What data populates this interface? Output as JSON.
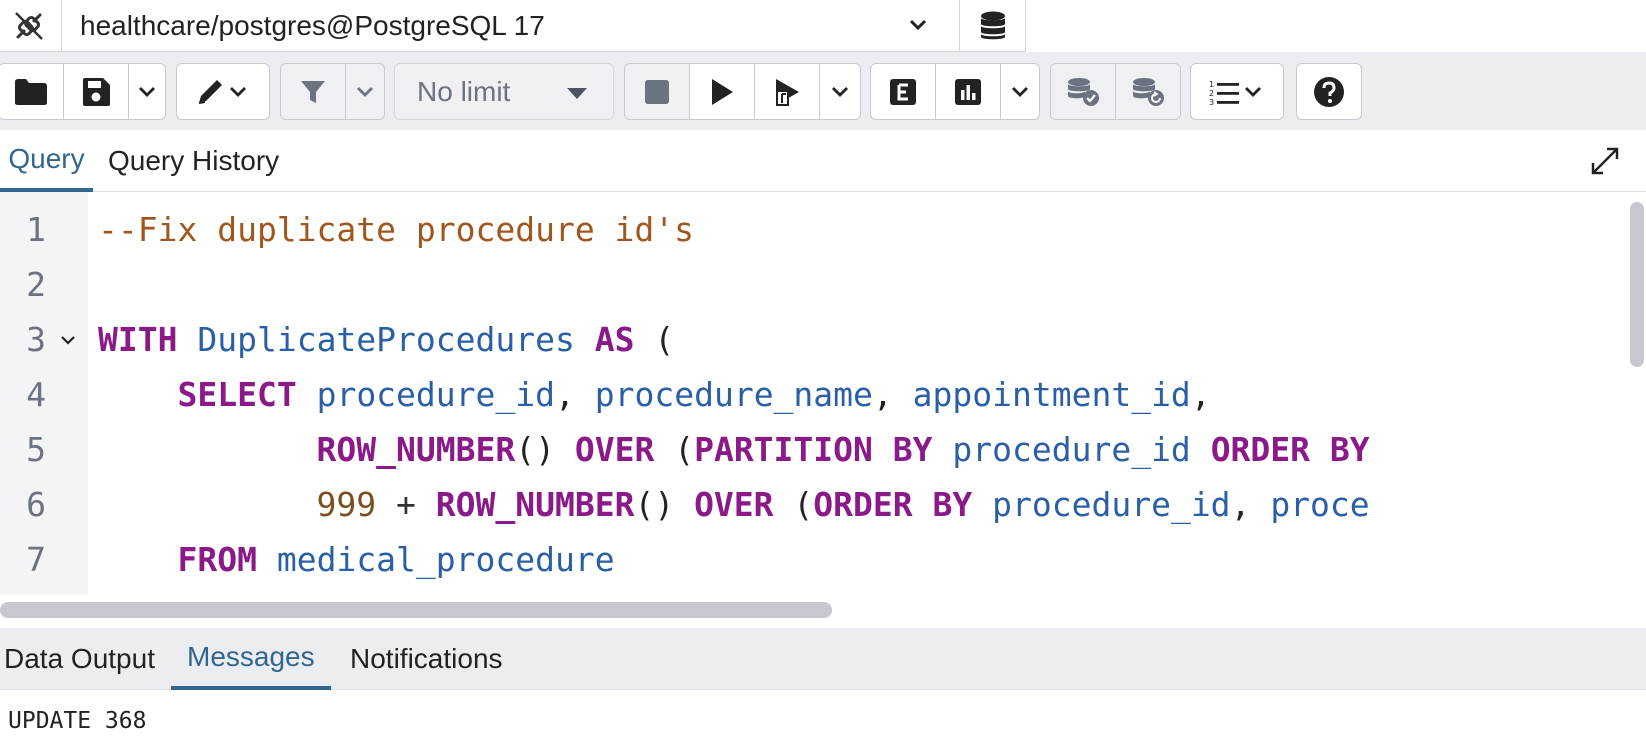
{
  "connection": {
    "label": "healthcare/postgres@PostgreSQL 17"
  },
  "toolbar": {
    "limit_label": "No limit"
  },
  "query_tabs": [
    {
      "label": "Query",
      "active": true
    },
    {
      "label": "Query History",
      "active": false
    }
  ],
  "editor": {
    "line_numbers": [
      "1",
      "2",
      "3",
      "4",
      "5",
      "6",
      "7"
    ],
    "lines": [
      [
        {
          "t": "--Fix duplicate procedure id's",
          "c": "comment"
        }
      ],
      [],
      [
        {
          "t": "WITH",
          "c": "kw"
        },
        {
          "t": " "
        },
        {
          "t": "DuplicateProcedures",
          "c": "ident"
        },
        {
          "t": " "
        },
        {
          "t": "AS",
          "c": "kw"
        },
        {
          "t": " ("
        }
      ],
      [
        {
          "t": "    "
        },
        {
          "t": "SELECT",
          "c": "kw"
        },
        {
          "t": " "
        },
        {
          "t": "procedure_id",
          "c": "ident"
        },
        {
          "t": ", "
        },
        {
          "t": "procedure_name",
          "c": "ident"
        },
        {
          "t": ", "
        },
        {
          "t": "appointment_id",
          "c": "ident"
        },
        {
          "t": ","
        }
      ],
      [
        {
          "t": "           "
        },
        {
          "t": "ROW_NUMBER",
          "c": "kw"
        },
        {
          "t": "() "
        },
        {
          "t": "OVER",
          "c": "kw"
        },
        {
          "t": " ("
        },
        {
          "t": "PARTITION",
          "c": "kw"
        },
        {
          "t": " "
        },
        {
          "t": "BY",
          "c": "kw"
        },
        {
          "t": " "
        },
        {
          "t": "procedure_id",
          "c": "ident"
        },
        {
          "t": " "
        },
        {
          "t": "ORDER",
          "c": "kw"
        },
        {
          "t": " "
        },
        {
          "t": "BY",
          "c": "kw"
        }
      ],
      [
        {
          "t": "           "
        },
        {
          "t": "999",
          "c": "num"
        },
        {
          "t": " + ",
          "c": "op"
        },
        {
          "t": "ROW_NUMBER",
          "c": "kw"
        },
        {
          "t": "() "
        },
        {
          "t": "OVER",
          "c": "kw"
        },
        {
          "t": " ("
        },
        {
          "t": "ORDER",
          "c": "kw"
        },
        {
          "t": " "
        },
        {
          "t": "BY",
          "c": "kw"
        },
        {
          "t": " "
        },
        {
          "t": "procedure_id",
          "c": "ident"
        },
        {
          "t": ", "
        },
        {
          "t": "proce",
          "c": "ident"
        }
      ],
      [
        {
          "t": "    "
        },
        {
          "t": "FROM",
          "c": "kw"
        },
        {
          "t": " "
        },
        {
          "t": "medical_procedure",
          "c": "ident"
        }
      ]
    ]
  },
  "result_tabs": [
    {
      "label": "Data Output",
      "active": false
    },
    {
      "label": "Messages",
      "active": true
    },
    {
      "label": "Notifications",
      "active": false
    }
  ],
  "messages": {
    "output": "UPDATE 368"
  },
  "colors": {
    "accent": "#326690",
    "keyword": "#8b1a89",
    "identifier": "#2a5fa8",
    "comment": "#a0561c",
    "number": "#7a4f1d"
  }
}
